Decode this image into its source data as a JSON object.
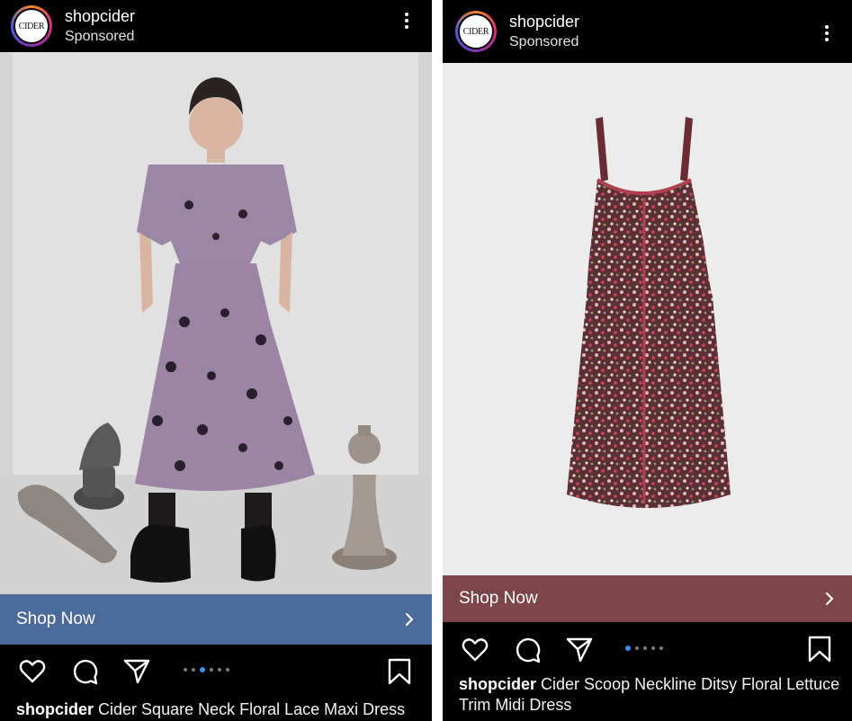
{
  "colors": {
    "background": "#000000",
    "left_cta": "#4d6b9a",
    "right_cta": "#7c4549",
    "active_dot": "#3b8ef0"
  },
  "posts": [
    {
      "avatar_text": "CIDER",
      "username": "shopcider",
      "sponsored": "Sponsored",
      "image_alt_icon": "model-in-lilac-dress-image",
      "cta_label": "Shop Now",
      "carousel_total": 6,
      "carousel_active": 3,
      "caption_user": "shopcider",
      "caption_text": " Cider Square Neck Floral Lace Maxi Dress"
    },
    {
      "avatar_text": "CIDER",
      "username": "shopcider",
      "sponsored": "Sponsored",
      "image_alt_icon": "ditsy-floral-dress-image",
      "cta_label": "Shop Now",
      "carousel_total": 5,
      "carousel_active": 1,
      "caption_user": "shopcider",
      "caption_text": " Cider Scoop Neckline Ditsy Floral Lettuce Trim Midi Dress"
    }
  ]
}
